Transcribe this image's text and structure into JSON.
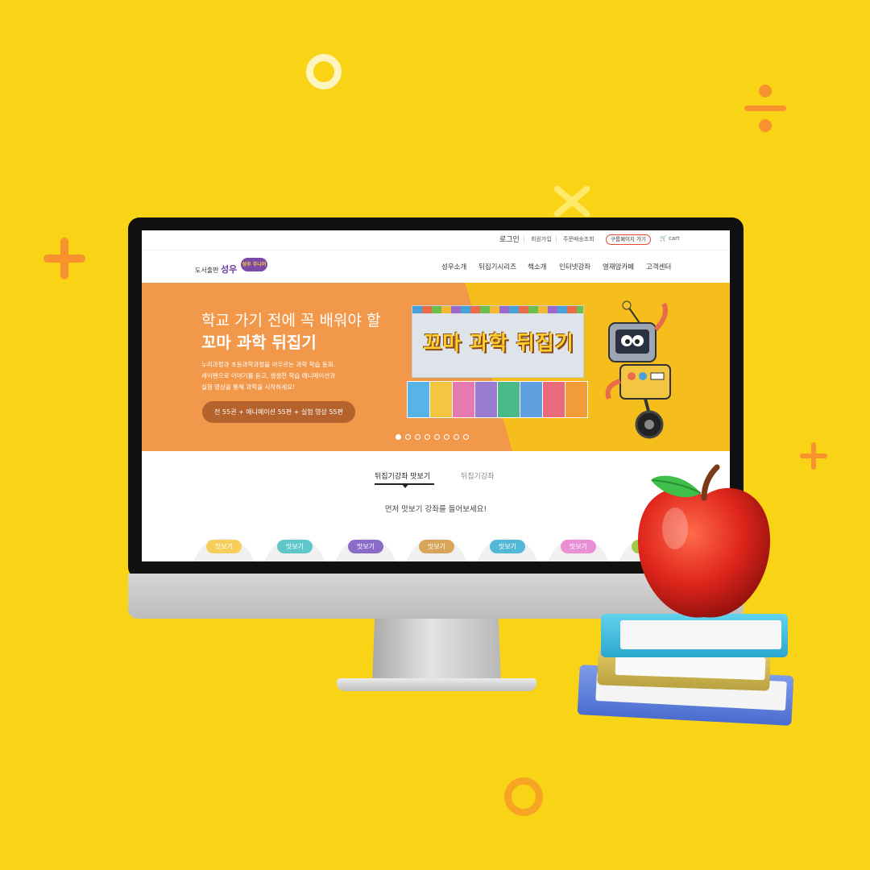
{
  "util_bar": {
    "login": "로그인",
    "signup": "회원가입",
    "order_lookup": "주문배송조회",
    "group_page_button": "구룹페이지 가기",
    "cart": "cart"
  },
  "header": {
    "logo_prefix": "도서출판",
    "logo_name": "성우",
    "logo_badge": "성우 주니어",
    "nav": [
      "성우소개",
      "뒤집기시리즈",
      "책소개",
      "인터넷강좌",
      "영재맘카페",
      "고객센터"
    ]
  },
  "banner": {
    "headline": "학교 가기 전에 꼭 배워야 할",
    "title": "꼬마 과학 뒤집기",
    "desc_lines": [
      "누리과정과 초등과학과정을 아우르는 과학 학습 동화.",
      "세이펜으로 이야기를 듣고, 생생한 학습 애니메이션과",
      "실험 영상을 통해 과학을 시작하세요!"
    ],
    "pill": "전 55권 + 애니메이션 55편 + 실험 영상 55편",
    "set_title": "꼬마 과학 뒤집기",
    "slides_total": 8,
    "slide_active": 1
  },
  "lessons": {
    "tab_active": "뒤집기강좌 맛보기",
    "tab_inactive": "뒤집기강좌",
    "subtitle": "먼저 맛보기 강좌를 들어보세요!",
    "tag_label": "맛보기",
    "tag_colors": [
      "#f6cf5a",
      "#5fc6c9",
      "#8a6bc7",
      "#d8a65a",
      "#53b8d8",
      "#e98fd6",
      "#a0c84a"
    ]
  },
  "colors": {
    "background": "#f9d416",
    "banner_orange": "#f1984a",
    "banner_yellow": "#f6be1c",
    "accent_red": "#e04a2f"
  }
}
